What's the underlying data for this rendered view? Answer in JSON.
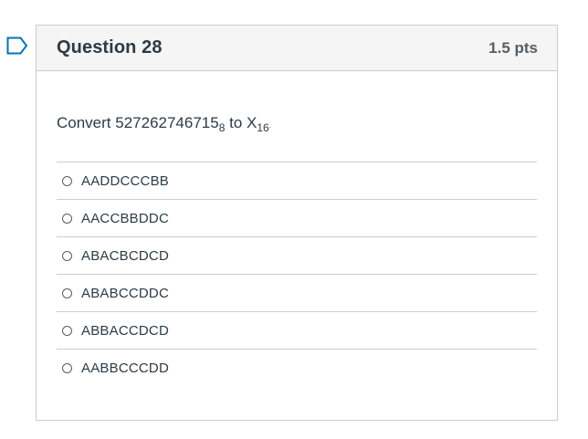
{
  "question": {
    "title": "Question 28",
    "points": "1.5 pts",
    "prompt": {
      "prefix": "Convert 527262746715",
      "base_from": "8",
      "middle": " to X",
      "base_to": "16",
      "suffix": "."
    },
    "answers": [
      {
        "label": "AADDCCCBB",
        "selected": false
      },
      {
        "label": "AACCBBDDC",
        "selected": false
      },
      {
        "label": "ABACBCDCD",
        "selected": false
      },
      {
        "label": "ABABCCDDC",
        "selected": false
      },
      {
        "label": "ABBACCDCD",
        "selected": false
      },
      {
        "label": "AABBCCCDD",
        "selected": false
      }
    ]
  },
  "colors": {
    "flag": "#0374b5",
    "header_bg": "#f5f5f5",
    "border": "#c7cdd1",
    "text": "#2d3b45"
  },
  "icons": {
    "flag": "flag-question-icon",
    "radio": "radio-button-icon"
  }
}
